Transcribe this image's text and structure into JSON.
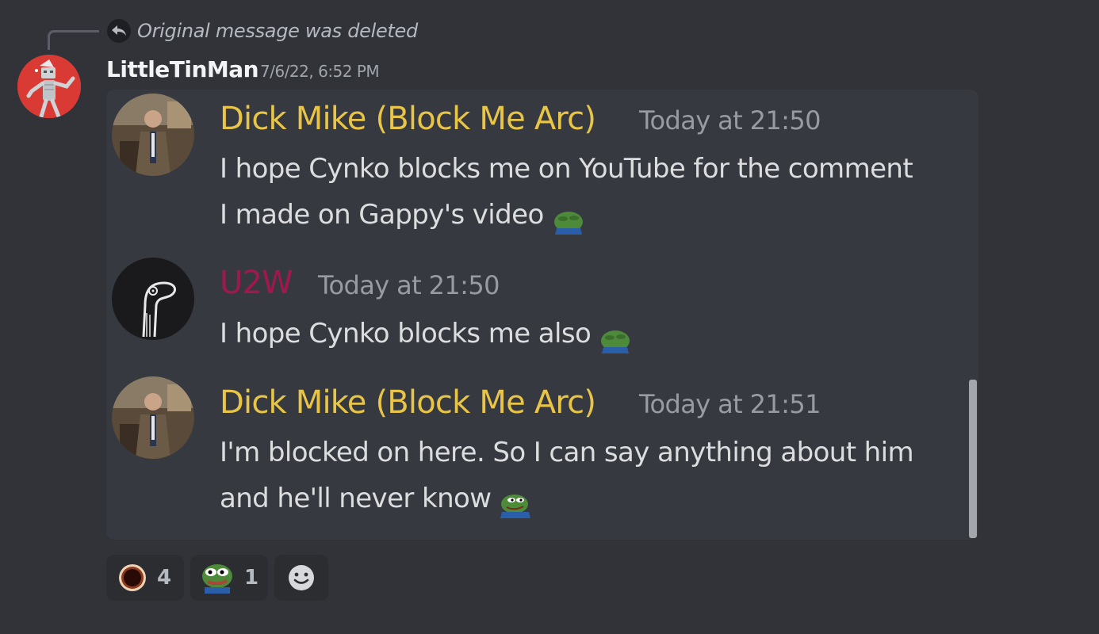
{
  "reply": {
    "text": "Original message was deleted"
  },
  "author": {
    "name": "LittleTinMan",
    "timestamp": "7/6/22, 6:52 PM"
  },
  "embedded_messages": [
    {
      "author": "Dick Mike (Block Me Arc)",
      "author_color": "#e8c547",
      "time": "Today at 21:50",
      "lines": [
        "I hope Cynko blocks me on YouTube for the comment",
        "I made on Gappy's video"
      ],
      "emoji": "pepe-hide-icon"
    },
    {
      "author": "U2W",
      "author_color": "#a3174f",
      "time": "Today at 21:50",
      "lines": [
        "I hope Cynko blocks me also"
      ],
      "emoji": "pepe-hide-icon"
    },
    {
      "author": "Dick Mike (Block Me Arc)",
      "author_color": "#e8c547",
      "time": "Today at 21:51",
      "lines": [
        "I'm blocked on here. So I can say anything about him",
        "and he'll never know"
      ],
      "emoji": "pepe-sneaky-icon"
    }
  ],
  "reactions": [
    {
      "emoji": "ring-icon",
      "count": "4"
    },
    {
      "emoji": "pepe-face-icon",
      "count": "1"
    }
  ],
  "add_reaction": {
    "icon": "smiley-icon"
  },
  "colors": {
    "background": "#313338",
    "card": "#36393f",
    "text": "#dcddde"
  }
}
